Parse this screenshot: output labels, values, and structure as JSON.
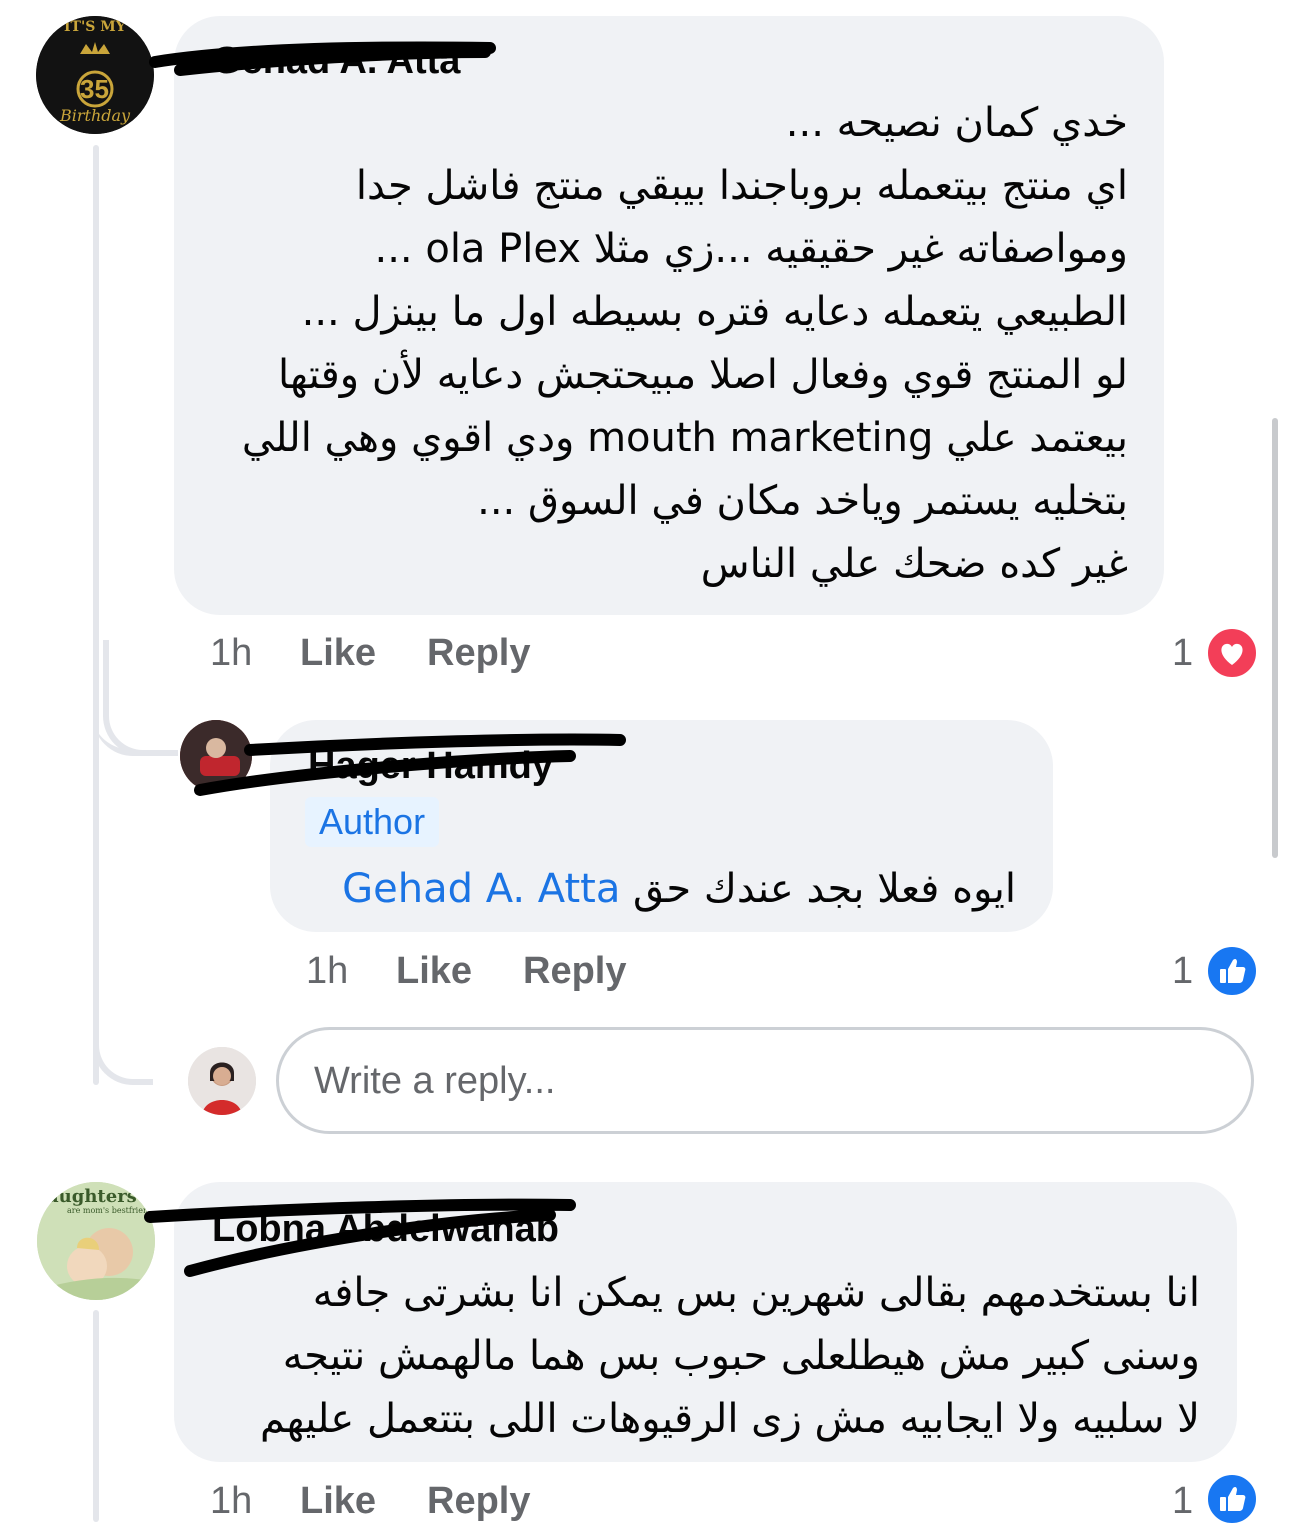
{
  "comments": [
    {
      "author": "Gehad A. Atta",
      "avatar_text": [
        "IT'S MY",
        "35",
        "Birthday"
      ],
      "lines": [
        "خدي كمان نصيحه ...",
        "اي منتج بيتعمله بروباجندا بيبقي منتج فاشل جدا",
        "ومواصفاته غير حقيقيه ...زي مثلا ola Plex ...",
        "الطبيعي يتعمله دعايه فتره بسيطه اول ما بينزل ...",
        "لو المنتج قوي وفعال اصلا مبيحتجش دعايه لأن وقتها",
        "بيعتمد علي mouth marketing  ودي اقوي وهي اللي",
        "بتخليه يستمر وياخد مكان في السوق ...",
        "غير كده ضحك علي الناس"
      ],
      "time": "1h",
      "like_label": "Like",
      "reply_label": "Reply",
      "reaction_count": "1",
      "reaction": "love-icon"
    },
    {
      "author": "Hager Hamdy",
      "badge": "Author",
      "mention": "Gehad A. Atta",
      "text": "ايوه فعلا بجد عندك حق",
      "time": "1h",
      "like_label": "Like",
      "reply_label": "Reply",
      "reaction_count": "1",
      "reaction": "like-icon"
    },
    {
      "author": "Lobna Abdelwahab",
      "avatar_text": [
        "aughters",
        "are mom's bestfriend"
      ],
      "lines": [
        "انا بستخدمهم بقالى  شهرين  بس يمكن انا بشرتى جافه",
        "وسنى كبير مش هيطلعلى حبوب بس هما  مالهمش نتيجه",
        "لا سلبيه ولا ايجابيه مش زى الرقيوهات اللى بتتعمل عليهم"
      ],
      "time": "1h",
      "like_label": "Like",
      "reply_label": "Reply",
      "reaction_count": "1",
      "reaction": "like-icon"
    }
  ],
  "reply_box": {
    "placeholder": "Write a reply..."
  },
  "colors": {
    "bubble": "#f0f2f5",
    "link": "#1b74e4",
    "meta": "#65676b",
    "love": "#f33e58",
    "like": "#1877f2"
  }
}
